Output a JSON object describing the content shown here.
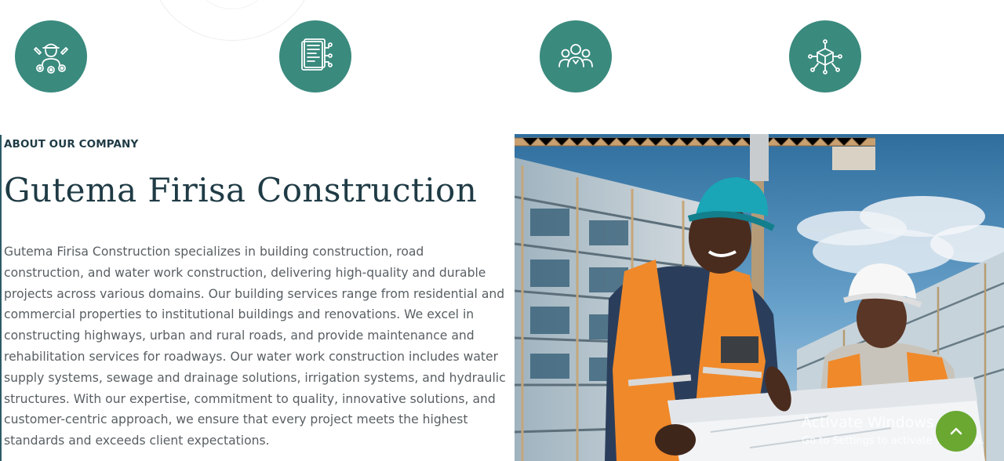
{
  "feature_icons": [
    {
      "icon": "engineer-gear-icon"
    },
    {
      "icon": "document-plan-icon"
    },
    {
      "icon": "team-people-icon"
    },
    {
      "icon": "network-cube-icon"
    }
  ],
  "about": {
    "eyebrow": "ABOUT OUR COMPANY",
    "title": "Gutema Firisa Construction",
    "description": "Gutema Firisa Construction specializes in building construction, road construction, and water work construction, delivering high-quality and durable projects across various domains. Our building services range from residential and commercial properties to institutional buildings and renovations. We excel in constructing highways, urban and rural roads, and provide maintenance and rehabilitation services for roadways. Our water work construction includes water supply systems, sewage and drainage solutions, irrigation systems, and hydraulic structures. With our expertise, commitment to quality, innovative solutions, and customer-centric approach, we ensure that every project meets the highest standards and exceeds client expectations."
  },
  "watermark": {
    "title": "Activate Windows",
    "subtitle": "Go to Settings to activate Windows."
  },
  "colors": {
    "accent_teal": "#3a8a7e",
    "heading": "#1f3b45",
    "body_text": "#585f63",
    "scroll_button": "#6aa832"
  },
  "scroll_top": {
    "icon": "chevron-up-icon"
  }
}
